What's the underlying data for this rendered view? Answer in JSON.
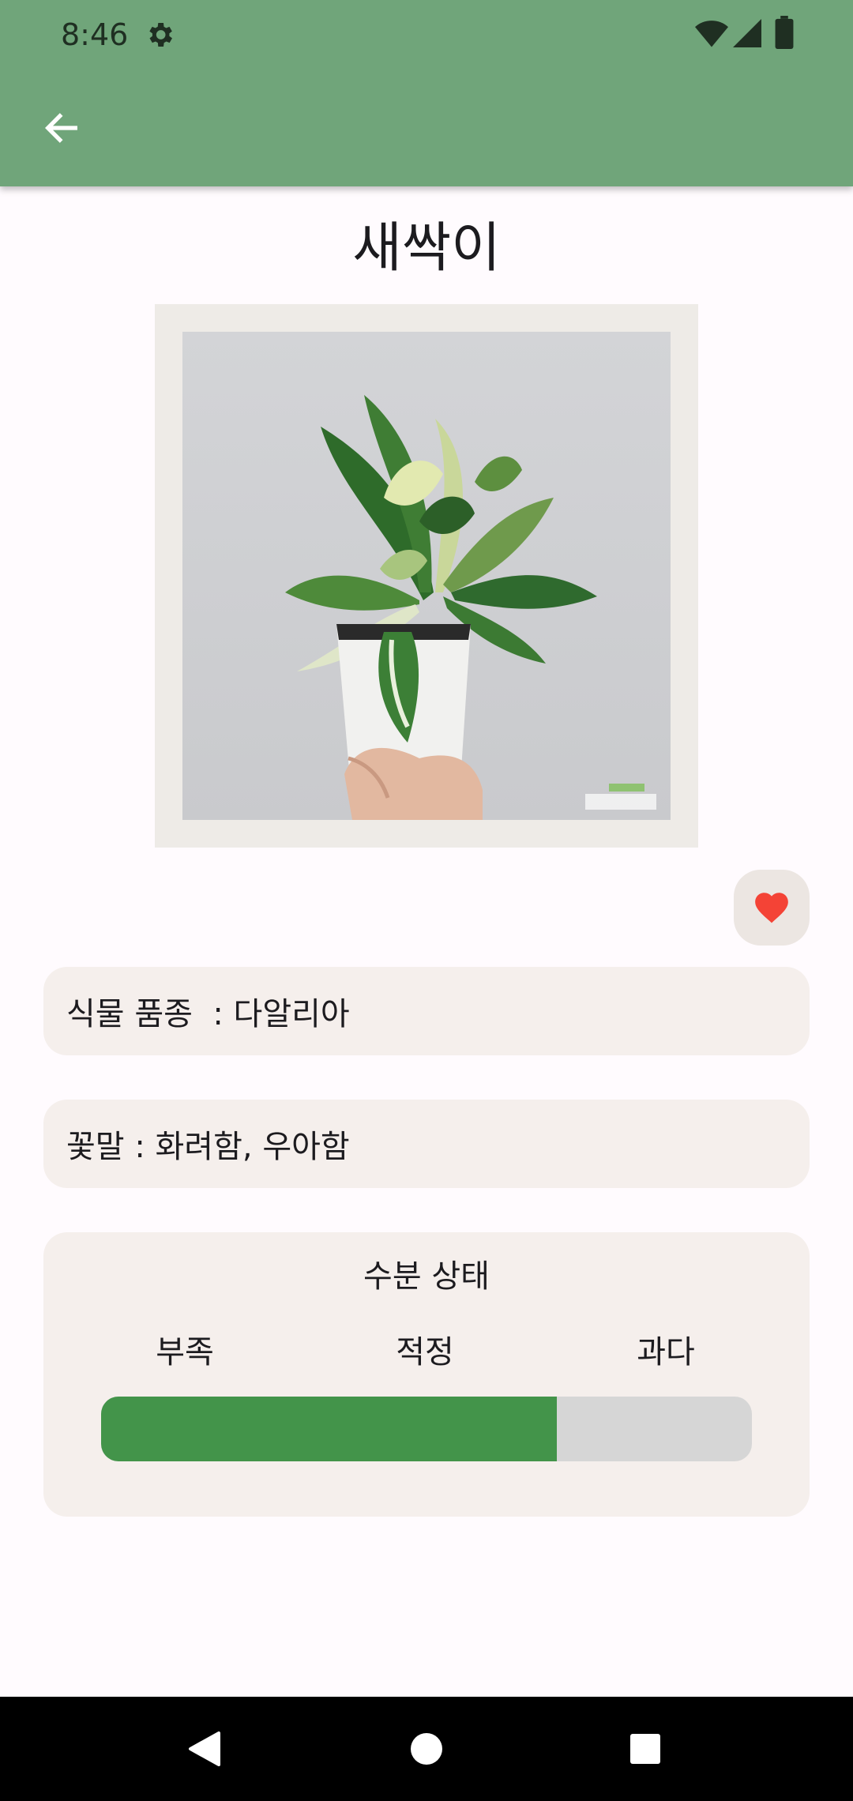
{
  "status_bar": {
    "time": "8:46",
    "icons": [
      "gear-icon",
      "wifi-icon",
      "signal-icon",
      "battery-icon"
    ]
  },
  "app_bar": {
    "back_icon": "arrow-left-icon",
    "background_color": "#70a57a"
  },
  "plant": {
    "name": "새싹이",
    "photo_description_icon": "plant-photo",
    "favorite_icon": "heart-icon",
    "favorite_color": "#f44336",
    "species_line": "식물 품종  : 다알리아",
    "flower_meaning_line": "꽃말 : 화려함, 우아함"
  },
  "water_status": {
    "title": "수분 상태",
    "labels": [
      "부족",
      "적정",
      "과다"
    ],
    "level_fraction": 0.7,
    "fill_color": "#43944a",
    "track_color": "#d6d6d6"
  },
  "nav_bar": {
    "icons": [
      "nav-back-icon",
      "nav-home-icon",
      "nav-recent-icon"
    ]
  }
}
